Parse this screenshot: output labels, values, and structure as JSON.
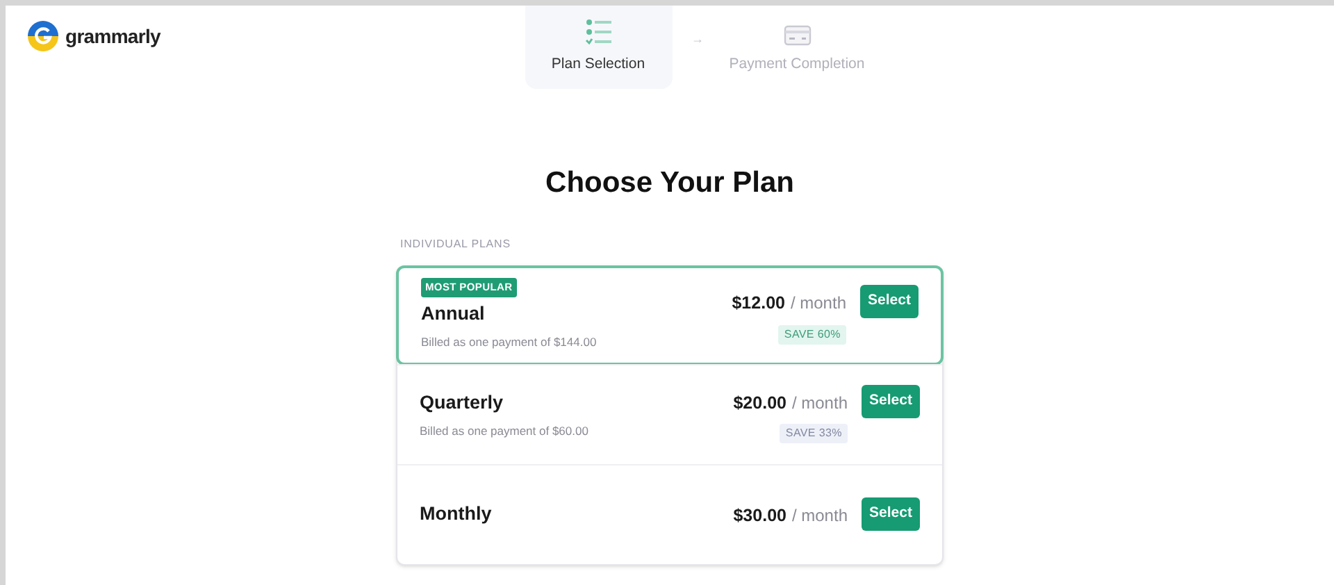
{
  "brand": {
    "name": "grammarly"
  },
  "steps": [
    {
      "label": "Plan Selection",
      "selected": true,
      "kind": "list"
    },
    {
      "label": "Payment Completion",
      "selected": false,
      "kind": "card"
    }
  ],
  "step_separator": "→",
  "title": "Choose Your Plan",
  "section_label": "INDIVIDUAL PLANS",
  "plans": [
    {
      "name": "Annual",
      "badge": "MOST POPULAR",
      "featured": true,
      "billing": "Billed as one payment of $144.00",
      "price": "$12.00",
      "period": "/ month",
      "save": "SAVE 60%",
      "button": "Select"
    },
    {
      "name": "Quarterly",
      "featured": false,
      "billing": "Billed as one payment of $60.00",
      "price": "$20.00",
      "period": "/ month",
      "save": "SAVE 33%",
      "button": "Select"
    },
    {
      "name": "Monthly",
      "featured": false,
      "price": "$30.00",
      "period": "/ month",
      "button": "Select"
    }
  ]
}
